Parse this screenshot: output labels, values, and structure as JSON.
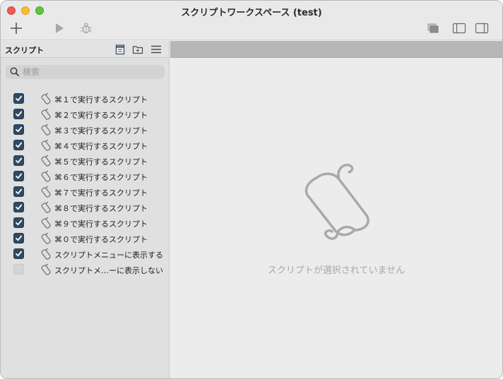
{
  "window": {
    "title": "スクリプトワークスペース (test)"
  },
  "toolbar": {
    "add_icon": "plus-icon",
    "run_icon": "play-icon",
    "debug_icon": "bug-icon",
    "right_icons": [
      "overlap-windows-icon",
      "left-sidebar-icon",
      "right-sidebar-icon"
    ]
  },
  "sidebar": {
    "title": "スクリプト",
    "search_placeholder": "検索",
    "items": [
      {
        "label": "⌘１で実行するスクリプト",
        "checked": true
      },
      {
        "label": "⌘２で実行するスクリプト",
        "checked": true
      },
      {
        "label": "⌘３で実行するスクリプト",
        "checked": true
      },
      {
        "label": "⌘４で実行するスクリプト",
        "checked": true
      },
      {
        "label": "⌘５で実行するスクリプト",
        "checked": true
      },
      {
        "label": "⌘６で実行するスクリプト",
        "checked": true
      },
      {
        "label": "⌘７で実行するスクリプト",
        "checked": true
      },
      {
        "label": "⌘８で実行するスクリプト",
        "checked": true
      },
      {
        "label": "⌘９で実行するスクリプト",
        "checked": true
      },
      {
        "label": "⌘０で実行するスクリプト",
        "checked": true
      },
      {
        "label": "スクリプトメニューに表示する",
        "checked": true
      },
      {
        "label": "スクリプトメ…ーに表示しない",
        "checked": false
      }
    ]
  },
  "main": {
    "empty_message": "スクリプトが選択されていません"
  },
  "colors": {
    "checkbox_on": "#2f4a63",
    "checkbox_off": "#d4d4d4",
    "empty_text": "#a8a8a8"
  }
}
